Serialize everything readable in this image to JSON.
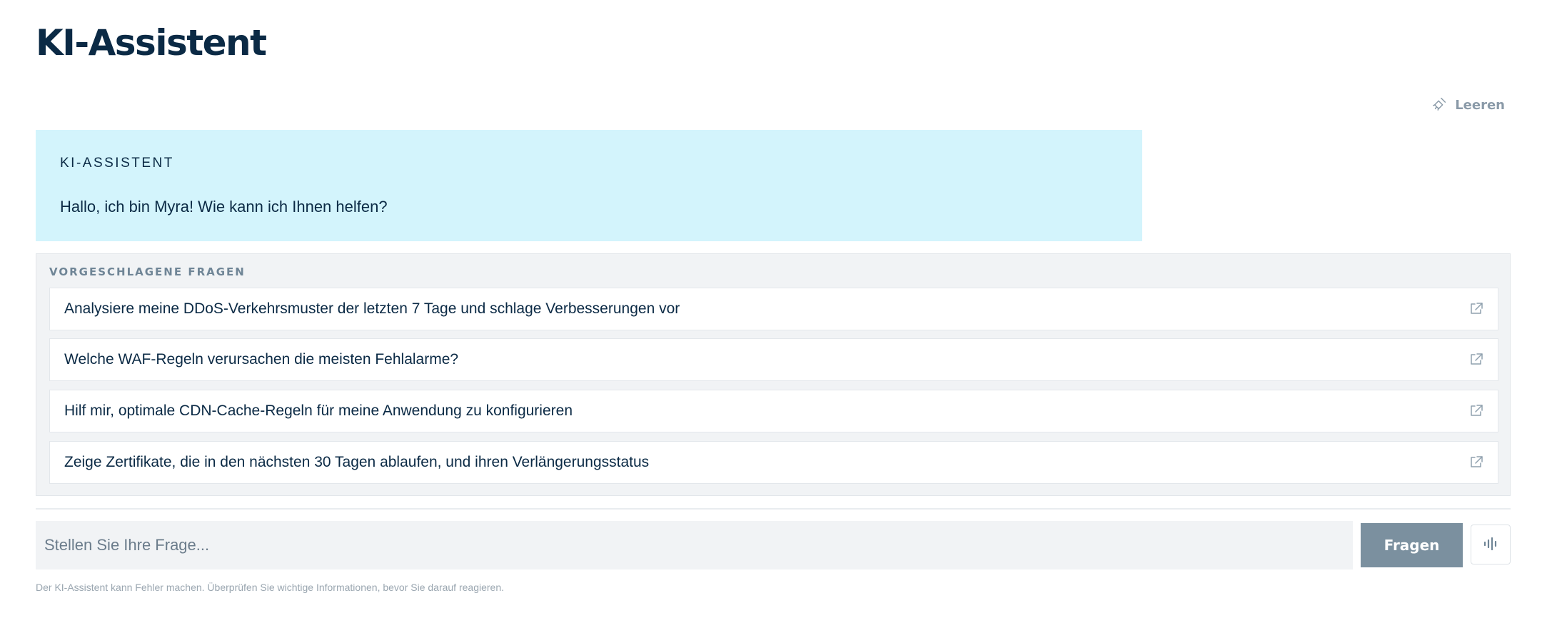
{
  "page": {
    "title": "KI-Assistent"
  },
  "toolbar": {
    "clear_label": "Leeren",
    "clear_icon": "broom-icon"
  },
  "chat": {
    "messages": [
      {
        "sender": "KI-ASSISTENT",
        "text": "Hallo, ich bin Myra! Wie kann ich Ihnen helfen?"
      }
    ]
  },
  "suggestions": {
    "heading": "VORGESCHLAGENE FRAGEN",
    "items": [
      {
        "text": "Analysiere meine DDoS-Verkehrsmuster der letzten 7 Tage und schlage Verbesserungen vor",
        "icon": "external-link-icon"
      },
      {
        "text": "Welche WAF-Regeln verursachen die meisten Fehlalarme?",
        "icon": "external-link-icon"
      },
      {
        "text": "Hilf mir, optimale CDN-Cache-Regeln für meine Anwendung zu konfigurieren",
        "icon": "external-link-icon"
      },
      {
        "text": "Zeige Zertifikate, die in den nächsten 30 Tagen ablaufen, und ihren Verlängerungsstatus",
        "icon": "external-link-icon"
      }
    ]
  },
  "input": {
    "placeholder": "Stellen Sie Ihre Frage...",
    "value": "",
    "submit_label": "Fragen",
    "voice_icon": "audio-waveform-icon"
  },
  "footer": {
    "disclaimer": "Der KI-Assistent kann Fehler machen. Überprüfen Sie wichtige Informationen, bevor Sie darauf reagieren."
  },
  "colors": {
    "title": "#0b2a45",
    "assistant_bubble": "#d3f4fc",
    "panel_background": "#f1f3f5",
    "submit_button": "#7b909f",
    "muted_text": "#8a9aa8"
  }
}
